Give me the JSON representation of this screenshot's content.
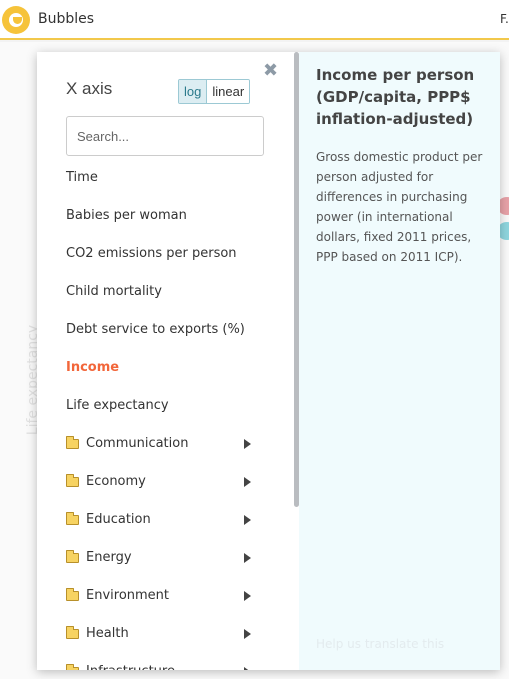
{
  "header": {
    "app_title": "Bubbles",
    "right_text": "F."
  },
  "background": {
    "y_axis_label": "Life expectancy"
  },
  "popup": {
    "title": "X axis",
    "scale_options": [
      "log",
      "linear"
    ],
    "scale_selected": "log",
    "search_placeholder": "Search...",
    "close_symbol": "✖",
    "menu_items": [
      {
        "label": "Time",
        "type": "indicator",
        "selected": false
      },
      {
        "label": "Babies per woman",
        "type": "indicator",
        "selected": false
      },
      {
        "label": "CO2 emissions per person",
        "type": "indicator",
        "selected": false
      },
      {
        "label": "Child mortality",
        "type": "indicator",
        "selected": false
      },
      {
        "label": "Debt service to exports (%)",
        "type": "indicator",
        "selected": false
      },
      {
        "label": "Income",
        "type": "indicator",
        "selected": true
      },
      {
        "label": "Life expectancy",
        "type": "indicator",
        "selected": false
      },
      {
        "label": "Communication",
        "type": "folder"
      },
      {
        "label": "Economy",
        "type": "folder"
      },
      {
        "label": "Education",
        "type": "folder"
      },
      {
        "label": "Energy",
        "type": "folder"
      },
      {
        "label": "Environment",
        "type": "folder"
      },
      {
        "label": "Health",
        "type": "folder"
      },
      {
        "label": "Infrastructure",
        "type": "folder"
      }
    ],
    "info": {
      "title": "Income per person (GDP/capita, PPP$ inflation-adjusted)",
      "description": "Gross domestic product per person adjusted for differences in purchasing power (in international dollars, fixed 2011 prices, PPP based on 2011 ICP).",
      "translate_link": "Help us translate this"
    }
  },
  "colors": {
    "accent_yellow": "#f6c33a",
    "selected_orange": "#f2663a",
    "info_bg": "#f0fbfd"
  }
}
